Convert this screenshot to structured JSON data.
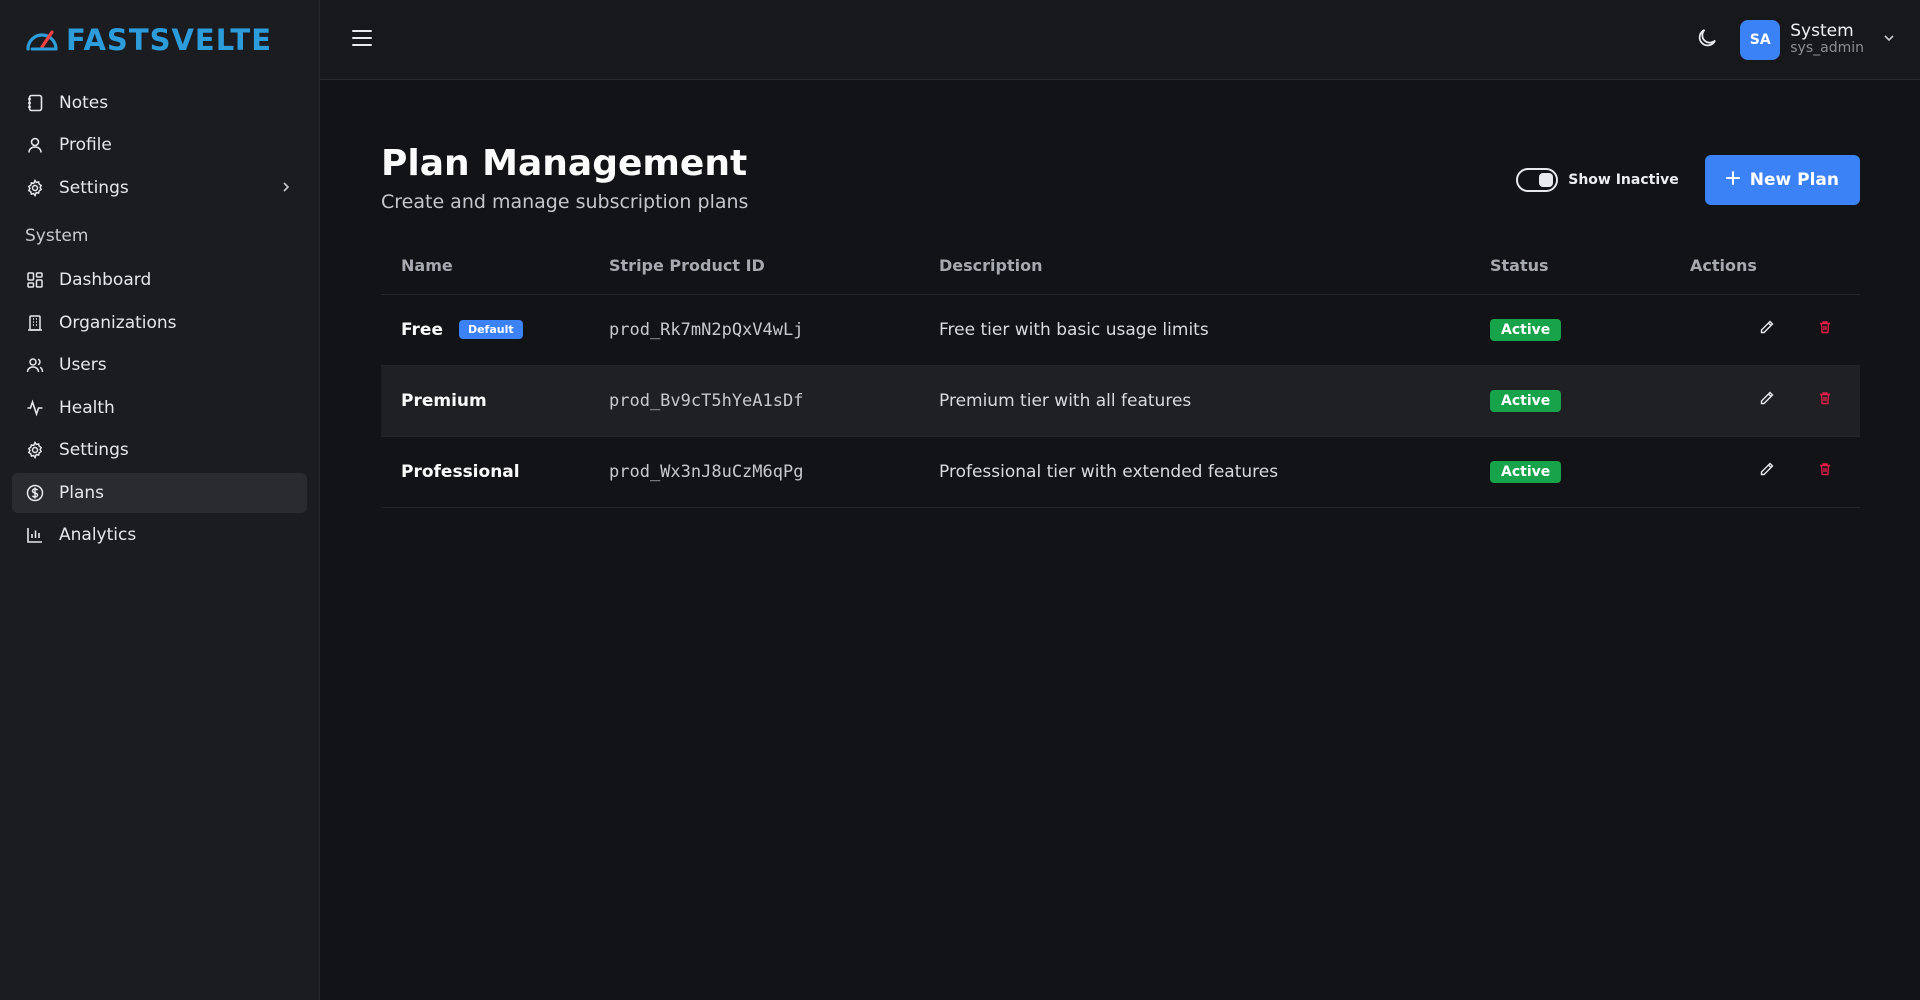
{
  "brand": {
    "name": "FASTSVELTE",
    "color": "#2d9cdb"
  },
  "sidebar": {
    "items": [
      {
        "label": "Notes",
        "icon": "notebook-icon"
      },
      {
        "label": "Profile",
        "icon": "user-icon"
      },
      {
        "label": "Settings",
        "icon": "gear-icon",
        "has_submenu": true
      }
    ],
    "section_label": "System",
    "system_items": [
      {
        "label": "Dashboard",
        "icon": "dashboard-icon"
      },
      {
        "label": "Organizations",
        "icon": "building-icon"
      },
      {
        "label": "Users",
        "icon": "users-icon"
      },
      {
        "label": "Health",
        "icon": "activity-icon"
      },
      {
        "label": "Settings",
        "icon": "gear-icon"
      },
      {
        "label": "Plans",
        "icon": "dollar-circle-icon",
        "active": true
      },
      {
        "label": "Analytics",
        "icon": "bar-chart-icon"
      }
    ]
  },
  "topbar": {
    "user": {
      "initials": "SA",
      "name": "System",
      "handle": "sys_admin"
    }
  },
  "page": {
    "title": "Plan Management",
    "subtitle": "Create and manage subscription plans",
    "toggle_label": "Show Inactive",
    "toggle_on": true,
    "new_button_label": "New Plan"
  },
  "table": {
    "headers": [
      "Name",
      "Stripe Product ID",
      "Description",
      "Status",
      "Actions"
    ],
    "rows": [
      {
        "name": "Free",
        "badge": "Default",
        "product_id": "prod_Rk7mN2pQxV4wLj",
        "description": "Free tier with basic usage limits",
        "status": "Active"
      },
      {
        "name": "Premium",
        "badge": "",
        "product_id": "prod_Bv9cT5hYeA1sDf",
        "description": "Premium tier with all features",
        "status": "Active"
      },
      {
        "name": "Professional",
        "badge": "",
        "product_id": "prod_Wx3nJ8uCzM6qPg",
        "description": "Professional tier with extended features",
        "status": "Active"
      }
    ]
  },
  "colors": {
    "accent": "#3b82f6",
    "success": "#16a34a",
    "danger": "#e11d48"
  }
}
